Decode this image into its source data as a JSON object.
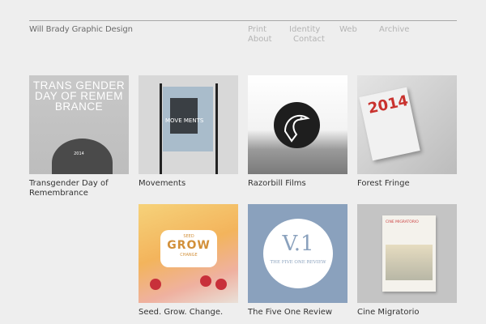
{
  "header": {
    "brand": "Will Brady Graphic Design",
    "nav": [
      "Print",
      "Identity",
      "Web",
      "Archive",
      "About",
      "Contact"
    ]
  },
  "projects": [
    {
      "title": "Transgender Day of Remembrance",
      "poster_text": "TRANS GENDER DAY OF REMEM BRANCE",
      "year": "2014"
    },
    {
      "title": "Movements",
      "poster_text": "MOVE MENTS"
    },
    {
      "title": "Razorbill Films"
    },
    {
      "title": "Forest Fringe",
      "poster_text": "2014"
    },
    {
      "title": "Seed. Grow. Change.",
      "label_top": "SEED",
      "label_main": "GROW",
      "label_bottom": "CHANGE"
    },
    {
      "title": "The Five One Review",
      "mark": "V.1",
      "subtitle": "THE FIVE ONE REVIEW"
    },
    {
      "title": "Cine Migratorio",
      "poster_text": "CINE MIGRATORIO"
    }
  ]
}
